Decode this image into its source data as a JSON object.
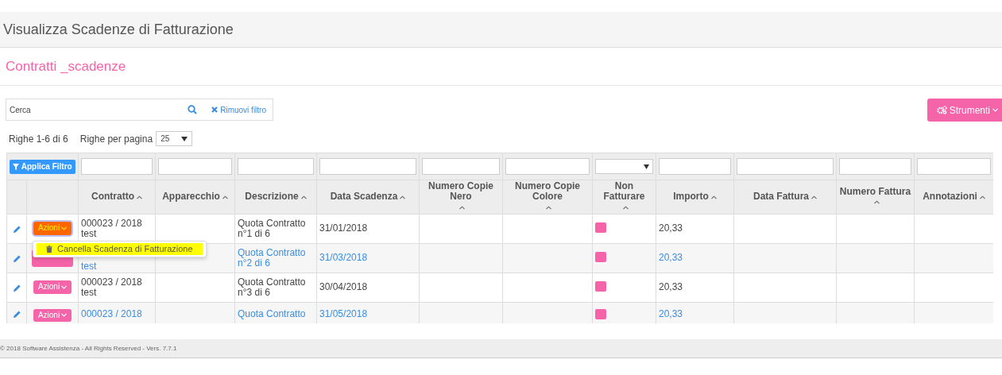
{
  "page_title": "Visualizza Scadenze di Fatturazione",
  "section_title": "Contratti _scadenze",
  "search": {
    "placeholder": "Cerca",
    "clear_label": "Rimuovi filtro"
  },
  "tools_button": "Strumenti",
  "pager": {
    "summary": "Righe 1-6 di 6",
    "per_page_label": "Righe per pagina",
    "per_page": "25"
  },
  "apply_filter": "Applica Filtro",
  "columns": [
    {
      "label": "Contratto",
      "kind": "text"
    },
    {
      "label": "Apparecchio",
      "kind": "text"
    },
    {
      "label": "Descrizione",
      "kind": "text"
    },
    {
      "label": "Data Scadenza",
      "kind": "text"
    },
    {
      "label": "Numero Copie Nero",
      "kind": "text"
    },
    {
      "label": "Numero Copie Colore",
      "kind": "text"
    },
    {
      "label": "Non Fatturare",
      "kind": "select"
    },
    {
      "label": "Importo",
      "kind": "text"
    },
    {
      "label": "Data Fattura",
      "kind": "text"
    },
    {
      "label": "Numero Fattura",
      "kind": "text"
    },
    {
      "label": "Annotazioni",
      "kind": "text"
    }
  ],
  "rows": [
    {
      "link": false,
      "menu_open": true,
      "actions": "Azioni",
      "contract": [
        "000023 / 2018",
        "test"
      ],
      "description": [
        "Quota Contratto",
        "n°1 di 6"
      ],
      "due_date": "31/01/2018",
      "non_fatturare": true,
      "amount": "20,33"
    },
    {
      "link": true,
      "menu_open": false,
      "contract": [
        "test"
      ],
      "description": [
        "Quota Contratto",
        "n°2 di 6"
      ],
      "due_date": "31/03/2018",
      "non_fatturare": true,
      "amount": "20,33"
    },
    {
      "link": false,
      "menu_open": false,
      "actions": "Azioni",
      "contract": [
        "000023 / 2018",
        "test"
      ],
      "description": [
        "Quota Contratto",
        "n°3 di 6"
      ],
      "due_date": "30/04/2018",
      "non_fatturare": true,
      "amount": "20,33"
    },
    {
      "link": true,
      "menu_open": false,
      "actions": "Azioni",
      "contract": [
        "000023 / 2018"
      ],
      "description": [
        "Quota Contratto"
      ],
      "due_date": "31/05/2018",
      "non_fatturare": true,
      "amount": "20,33"
    }
  ],
  "actions_menu": {
    "items": [
      {
        "label": "Cancella Scadenza di Fatturazione",
        "highlighted": true
      }
    ]
  },
  "footer": "© 2018 Software Assistenza - All Rights Reserved - Vers. 7.7.1"
}
